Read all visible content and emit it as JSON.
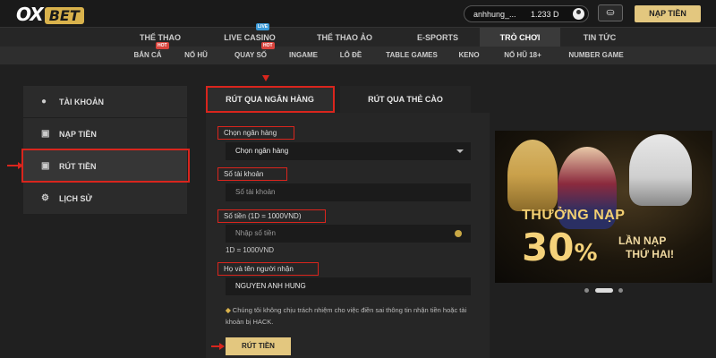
{
  "header": {
    "logo_ox": "OX",
    "logo_bet": "BET",
    "username": "anhhung_...",
    "balance": "1.233 D",
    "deposit_button": "NẠP TIỀN",
    "gift_icon": "gift-icon",
    "avatar_icon": "user-avatar-icon"
  },
  "main_nav": [
    {
      "label": "THỂ THAO"
    },
    {
      "label": "LIVE CASINO",
      "badge": "LIVE"
    },
    {
      "label": "THỂ THAO ẢO"
    },
    {
      "label": "E-SPORTS"
    },
    {
      "label": "TRÒ CHƠI",
      "active": true
    },
    {
      "label": "TIN TỨC"
    }
  ],
  "sub_nav": [
    {
      "label": "BẮN CÁ",
      "badge": "HOT"
    },
    {
      "label": "NỔ HŨ"
    },
    {
      "label": "QUAY SỐ",
      "badge": "HOT"
    },
    {
      "label": "INGAME"
    },
    {
      "label": "LÔ ĐỀ"
    },
    {
      "label": "TABLE GAMES"
    },
    {
      "label": "KENO"
    },
    {
      "label": "NỔ HŨ 18+"
    },
    {
      "label": "NUMBER GAME"
    }
  ],
  "sidebar": {
    "items": [
      {
        "label": "TÀI KHOẢN",
        "icon": "user-icon"
      },
      {
        "label": "NẠP TIỀN",
        "icon": "deposit-icon"
      },
      {
        "label": "RÚT TIỀN",
        "icon": "withdraw-icon",
        "active": true
      },
      {
        "label": "LỊCH SỬ",
        "icon": "history-icon"
      }
    ]
  },
  "form": {
    "tabs": [
      {
        "label": "RÚT QUA NGÂN HÀNG",
        "active": true
      },
      {
        "label": "RÚT QUA THẺ CÀO"
      }
    ],
    "bank_label": "Chọn ngân hàng",
    "bank_value": "Chọn ngân hàng",
    "account_label": "Số tài khoản",
    "account_placeholder": "Số tài khoản",
    "amount_label": "Số tiền (1D = 1000VND)",
    "amount_placeholder": "Nhập số tiền",
    "rate_note": "1D = 1000VND",
    "name_label": "Họ và tên người nhận",
    "name_value": "NGUYEN ANH HUNG",
    "disclaimer": "Chúng tôi không chịu trách nhiệm cho việc điền sai thông tin nhận tiền hoặc tài khoản bị HACK.",
    "submit": "RÚT TIỀN"
  },
  "promo": {
    "line1": "THƯỞNG NẠP",
    "number": "30",
    "percent": "%",
    "line3a": "LẦN NẠP",
    "line3b": "THỨ HAI!"
  },
  "colors": {
    "accent": "#e3c77f",
    "highlight": "#d9251d",
    "background": "#1c1c1c"
  }
}
